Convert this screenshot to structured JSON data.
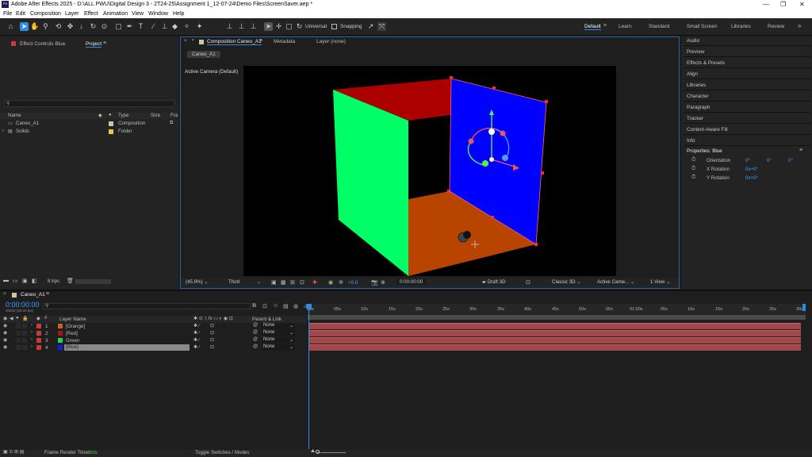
{
  "window": {
    "title": "Adobe After Effects 2025 - D:\\ALL PWU\\Digital Design 3 - 2T24-25\\Assignment 1_12-07-24\\Demo Files\\ScreenSaver.aep *",
    "app_icon": "Ae"
  },
  "menu": [
    "File",
    "Edit",
    "Composition",
    "Layer",
    "Effect",
    "Animation",
    "View",
    "Window",
    "Help"
  ],
  "toolbar": {
    "universal_label": "Universal",
    "snapping_label": "Snapping"
  },
  "workspaces": [
    "Default",
    "Learn",
    "Standard",
    "Small Screen",
    "Libraries",
    "Review"
  ],
  "left_panel": {
    "effect_controls_tab": "Effect Controls Blue",
    "project_tab": "Project",
    "columns": [
      "Name",
      "Type",
      "Size",
      "Fra"
    ],
    "items": [
      {
        "name": "Caneo_A1",
        "type": "Composition",
        "color": "#c8c8a0"
      },
      {
        "name": "Solids",
        "type": "Folder",
        "color": "#e8c84a"
      }
    ],
    "bpc": "8 bpc"
  },
  "comp_panel": {
    "tab": "Composition Caneo_A1",
    "metadata_tab": "Metadata",
    "layer_tab": "Layer (none)",
    "comp_button": "Caneo_A1",
    "camera_label": "Active Camera (Default)",
    "zoom": "(45.9%)",
    "quality": "Third",
    "exposure": "+0.0",
    "timecode": "0:00:00:00",
    "draft3d": "Draft 3D",
    "renderer": "Classic 3D",
    "camera": "Active Came...",
    "views": "1 View"
  },
  "right_panel": {
    "items": [
      "Audio",
      "Preview",
      "Effects & Presets",
      "Align",
      "Libraries",
      "Character",
      "Paragraph",
      "Tracker",
      "Content-Aware Fill",
      "Info"
    ],
    "properties_title": "Properties: Blue",
    "props": [
      {
        "label": "Orientation",
        "value": "0°",
        "v2": "0°",
        "v3": "0°"
      },
      {
        "label": "X Rotation",
        "value": "0x+0°"
      },
      {
        "label": "Y Rotation",
        "value": "0x+0°"
      }
    ]
  },
  "timeline": {
    "tab": "Caneo_A1",
    "timecode": "0:00:00:00",
    "fps": "00000 (30.00 fps)",
    "col_layer_name": "Layer Name",
    "col_parent": "Parent & Link",
    "layers": [
      {
        "num": "1",
        "name": "[Orange]",
        "color": "#c8642a",
        "parent": "None"
      },
      {
        "num": "2",
        "name": "[Red]",
        "color": "#b01010",
        "parent": "None"
      },
      {
        "num": "3",
        "name": "Green",
        "color": "#20d060",
        "parent": "None"
      },
      {
        "num": "4",
        "name": "[Blue]",
        "color": "#1020e0",
        "parent": "None"
      }
    ],
    "ruler": [
      "0s",
      "05s",
      "10s",
      "15s",
      "20s",
      "25s",
      "30s",
      "35s",
      "40s",
      "45s",
      "50s",
      "55s",
      "01:00s",
      "05s",
      "10s",
      "15s",
      "20s",
      "25s",
      "30s"
    ],
    "footer_render": "Frame Render Time:",
    "footer_render_value": "8ms",
    "footer_toggle": "Toggle Switches / Modes"
  },
  "colors": {
    "accent": "#2d8ceb",
    "timecode": "#3aa0ff",
    "bar": "#a0484a"
  }
}
